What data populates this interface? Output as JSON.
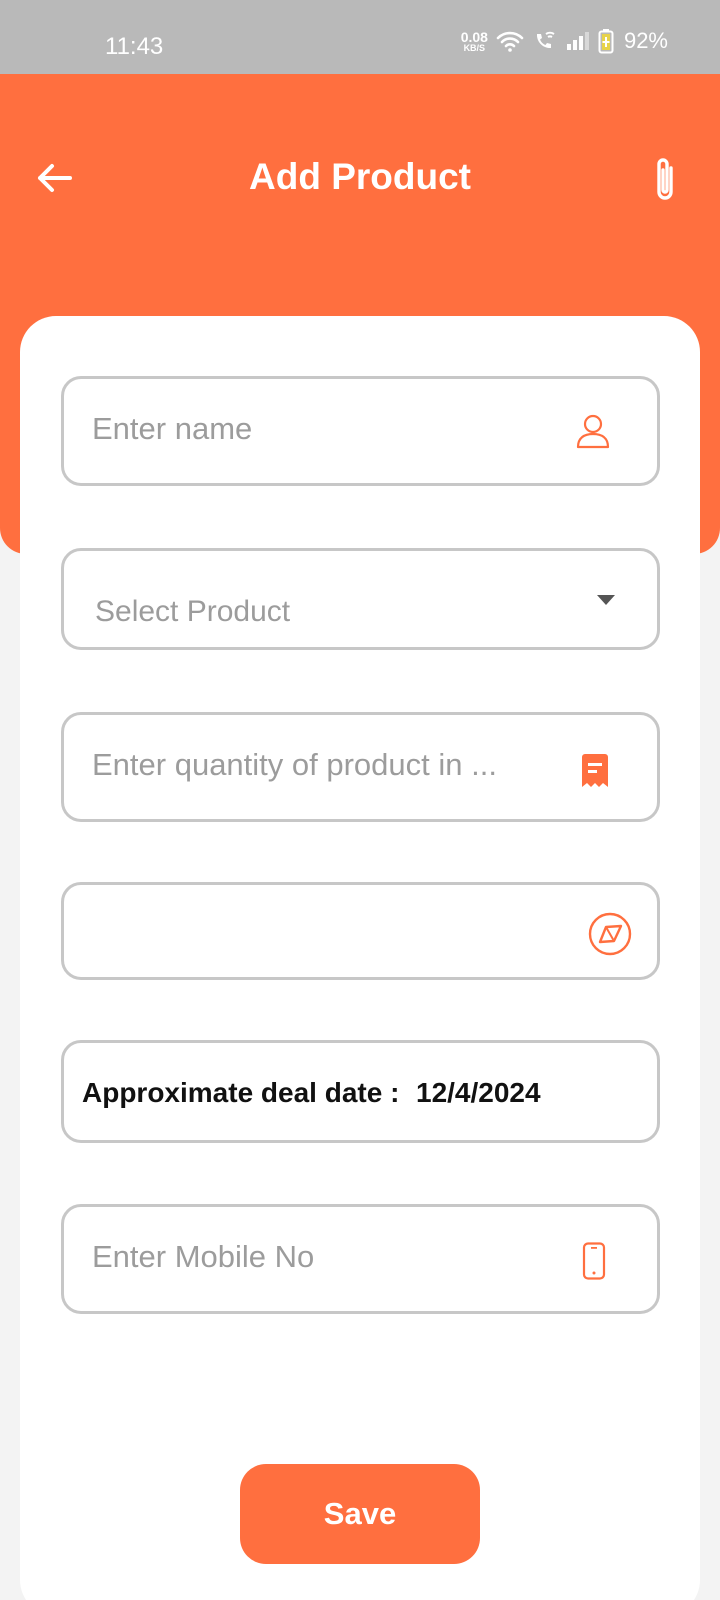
{
  "status_bar": {
    "time": "11:43",
    "net_speed_value": "0.08",
    "net_speed_unit": "KB/S",
    "battery_percent": "92%"
  },
  "header": {
    "title": "Add Product",
    "back_icon": "arrow-left-icon",
    "attach_icon": "paperclip-icon"
  },
  "form": {
    "name_placeholder": "Enter name",
    "product_select_placeholder": "Select Product",
    "quantity_placeholder": "Enter quantity of product in ...",
    "location_value": "",
    "deal_date_label": "Approximate deal date :",
    "deal_date_value": "12/4/2024",
    "mobile_placeholder": "Enter Mobile No"
  },
  "actions": {
    "save_label": "Save"
  },
  "colors": {
    "accent": "#FF6F3F",
    "status_bar": "#B9B9B9",
    "field_border": "#C7C7C7",
    "placeholder": "#9C9C9C"
  }
}
